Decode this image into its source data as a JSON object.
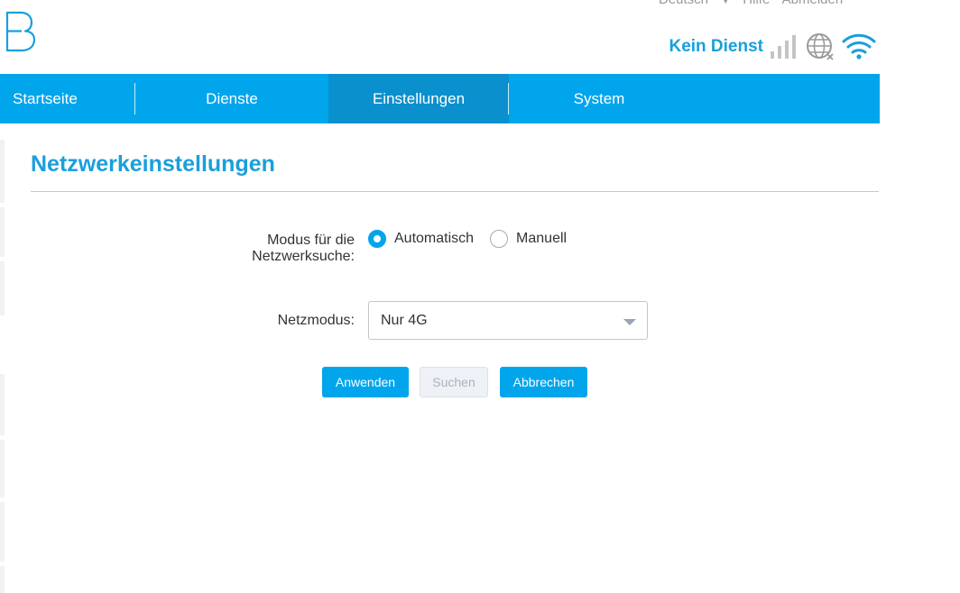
{
  "topbar": {
    "language": "Deutsch",
    "help": "Hilfe",
    "logout": "Abmelden"
  },
  "status": {
    "service_text": "Kein Dienst"
  },
  "icons": {
    "signal": "signal-bars-icon",
    "globe": "globe-disconnected-icon",
    "wifi": "wifi-icon",
    "logo": "brand-logo-icon"
  },
  "colors": {
    "accent": "#00a5ec",
    "active_tab": "#0a90cc",
    "title": "#1a9fdc"
  },
  "nav": {
    "items": [
      {
        "label": "Startseite"
      },
      {
        "label": "Dienste"
      },
      {
        "label": "Einstellungen"
      },
      {
        "label": "System"
      }
    ],
    "active": "Einstellungen"
  },
  "main": {
    "title": "Netzwerkeinstellungen",
    "search_mode": {
      "label_line1": "Modus für die",
      "label_line2": "Netzwerksuche:",
      "options": [
        {
          "label": "Automatisch",
          "selected": true
        },
        {
          "label": "Manuell",
          "selected": false
        }
      ]
    },
    "network_mode": {
      "label": "Netzmodus:",
      "value": "Nur 4G"
    },
    "buttons": {
      "apply": "Anwenden",
      "search": "Suchen",
      "cancel": "Abbrechen"
    }
  }
}
